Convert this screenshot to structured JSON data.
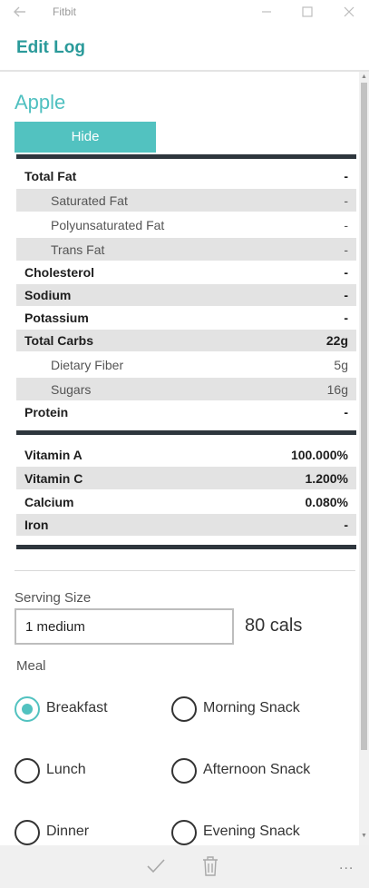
{
  "window": {
    "app_title": "Fitbit",
    "icons": [
      "back-arrow-icon",
      "minimize-icon",
      "maximize-icon",
      "close-icon"
    ]
  },
  "header": {
    "title": "Edit Log"
  },
  "food": {
    "name": "Apple",
    "hide_label": "Hide"
  },
  "nutrition": {
    "rows": [
      {
        "label": "Total Fat",
        "value": "-"
      },
      {
        "label": "Saturated Fat",
        "value": "-"
      },
      {
        "label": "Polyunsaturated Fat",
        "value": "-"
      },
      {
        "label": "Trans Fat",
        "value": "-"
      },
      {
        "label": "Cholesterol",
        "value": "-"
      },
      {
        "label": "Sodium",
        "value": "-"
      },
      {
        "label": "Potassium",
        "value": "-"
      },
      {
        "label": "Total Carbs",
        "value": "22g"
      },
      {
        "label": "Dietary Fiber",
        "value": "5g"
      },
      {
        "label": "Sugars",
        "value": "16g"
      },
      {
        "label": "Protein",
        "value": "-"
      }
    ],
    "vitamins": [
      {
        "label": "Vitamin A",
        "value": "100.000%"
      },
      {
        "label": "Vitamin C",
        "value": "1.200%"
      },
      {
        "label": "Calcium",
        "value": "0.080%"
      },
      {
        "label": "Iron",
        "value": "-"
      }
    ]
  },
  "serving": {
    "label": "Serving Size",
    "value": "1 medium",
    "cals": "80 cals"
  },
  "meal": {
    "label": "Meal",
    "selected": "Breakfast",
    "options": [
      "Breakfast",
      "Morning Snack",
      "Lunch",
      "Afternoon Snack",
      "Dinner",
      "Evening Snack"
    ]
  },
  "bottom_bar": {
    "icons": [
      "checkmark-icon",
      "trash-icon",
      "more-options-icon"
    ],
    "more_label": "..."
  },
  "colors": {
    "accent": "#52c2c0",
    "title": "#2a9a9a",
    "table_bar": "#2e363d",
    "row_shade": "#e3e3e3"
  }
}
